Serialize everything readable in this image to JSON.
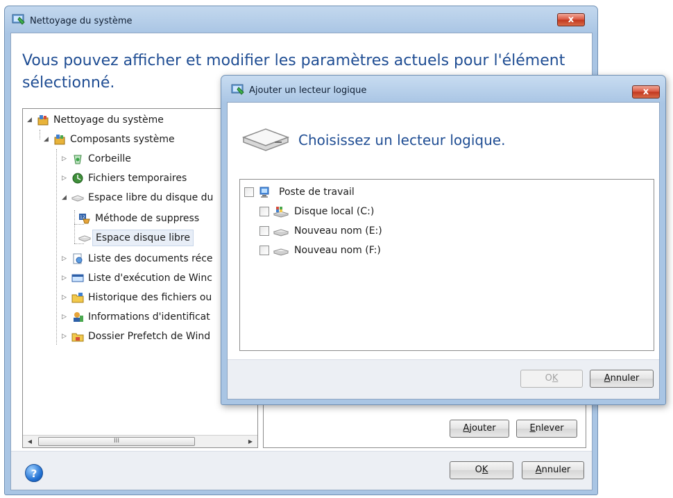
{
  "main_window": {
    "title": "Nettoyage du système",
    "close_label": "x",
    "heading": "Vous pouvez afficher et modifier les paramètres actuels pour l'élément sélectionné.",
    "tree": [
      {
        "label": "Nettoyage du système",
        "icon": "system-cleanup-icon"
      },
      {
        "label": "Composants système",
        "icon": "system-components-icon"
      },
      {
        "label": "Corbeille",
        "icon": "recycle-bin-icon"
      },
      {
        "label": "Fichiers temporaires",
        "icon": "temp-files-icon"
      },
      {
        "label": "Espace libre du disque du",
        "icon": "disk-free-space-icon"
      },
      {
        "label": "Méthode de suppress",
        "icon": "deletion-method-icon"
      },
      {
        "label": "Espace disque libre",
        "icon": "disk-icon"
      },
      {
        "label": "Liste des documents réce",
        "icon": "recent-documents-icon"
      },
      {
        "label": "Liste d'exécution de Winc",
        "icon": "run-list-icon"
      },
      {
        "label": "Historique des fichiers ou",
        "icon": "file-history-icon"
      },
      {
        "label": "Informations d'identificat",
        "icon": "credentials-icon"
      },
      {
        "label": "Dossier Prefetch de Wind",
        "icon": "prefetch-folder-icon"
      }
    ],
    "scroll_thumb_label": "III",
    "add_button": {
      "pre": "",
      "key": "A",
      "post": "jouter"
    },
    "remove_button": {
      "pre": "",
      "key": "E",
      "post": "nlever"
    },
    "ok_button": {
      "pre": "O",
      "key": "K",
      "post": ""
    },
    "cancel_button": {
      "pre": "",
      "key": "A",
      "post": "nnuler"
    },
    "help_label": "?"
  },
  "dialog": {
    "title": "Ajouter un lecteur logique",
    "close_label": "x",
    "heading": "Choisissez un lecteur logique.",
    "drives": [
      {
        "label": "Poste de travail",
        "icon": "computer-icon",
        "checked": false
      },
      {
        "label": "Disque local (C:)",
        "icon": "local-disk-icon",
        "checked": false
      },
      {
        "label": "Nouveau nom (E:)",
        "icon": "drive-icon",
        "checked": false
      },
      {
        "label": "Nouveau nom (F:)",
        "icon": "drive-icon",
        "checked": false
      }
    ],
    "ok_button": {
      "pre": "O",
      "key": "K",
      "post": ""
    },
    "cancel_button": {
      "pre": "",
      "key": "A",
      "post": "nnuler"
    }
  },
  "colors": {
    "heading": "#1f4d93",
    "titlebar": "#c3d8ee",
    "close": "#d9543d"
  }
}
